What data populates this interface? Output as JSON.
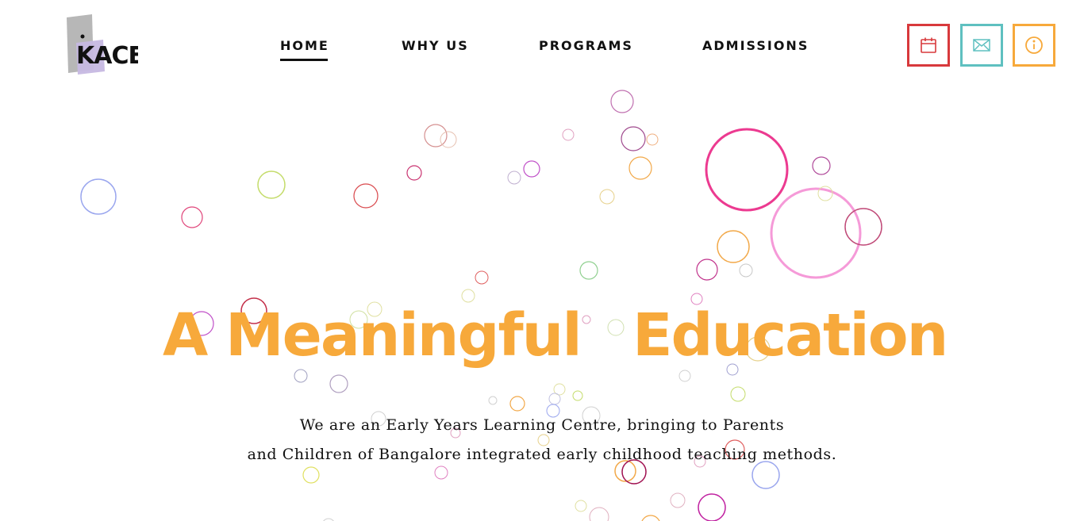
{
  "logo": {
    "text": "KACE"
  },
  "nav": {
    "items": [
      {
        "label": "HOME",
        "active": true
      },
      {
        "label": "WHY US",
        "active": false
      },
      {
        "label": "PROGRAMS",
        "active": false
      },
      {
        "label": "ADMISSIONS",
        "active": false
      }
    ]
  },
  "header_icons": [
    {
      "icon": "calendar-icon",
      "color": "#d8393c"
    },
    {
      "icon": "mail-icon",
      "color": "#5fc0c0"
    },
    {
      "icon": "info-icon",
      "color": "#f7a93b"
    }
  ],
  "hero": {
    "title_words": [
      "A",
      "Meaningful",
      "Education"
    ],
    "subtitle_lines": [
      "We are an Early Years Learning Centre, bringing to Parents",
      "and Children of Bangalore integrated early childhood teaching methods."
    ]
  },
  "colors": {
    "accent": "#f7a93b",
    "text": "#111111",
    "background": "#ffffff"
  }
}
